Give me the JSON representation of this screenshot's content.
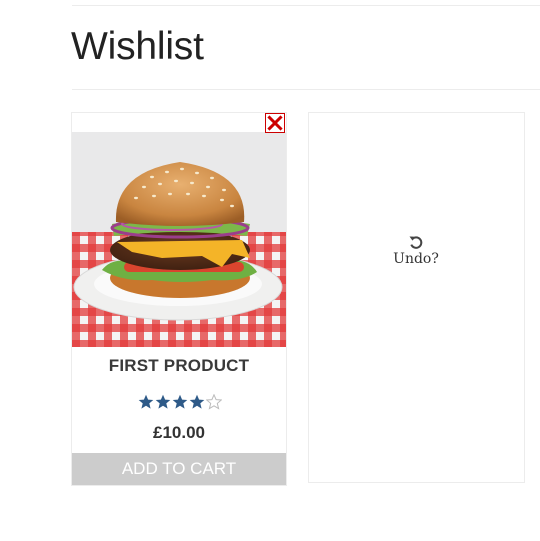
{
  "page": {
    "title": "Wishlist"
  },
  "product": {
    "name": "FIRST PRODUCT",
    "price": "£10.00",
    "rating": 4,
    "rating_max": 5,
    "image": "hamburger-on-plate-icon",
    "add_to_cart_label": "ADD TO CART",
    "remove_icon": "close-icon"
  },
  "undo": {
    "label": "Undo?",
    "icon": "undo-icon"
  },
  "colors": {
    "star_filled": "#2e5a88",
    "star_empty": "#bbbbbb",
    "remove": "#cc0000",
    "button": "#cccccc"
  }
}
